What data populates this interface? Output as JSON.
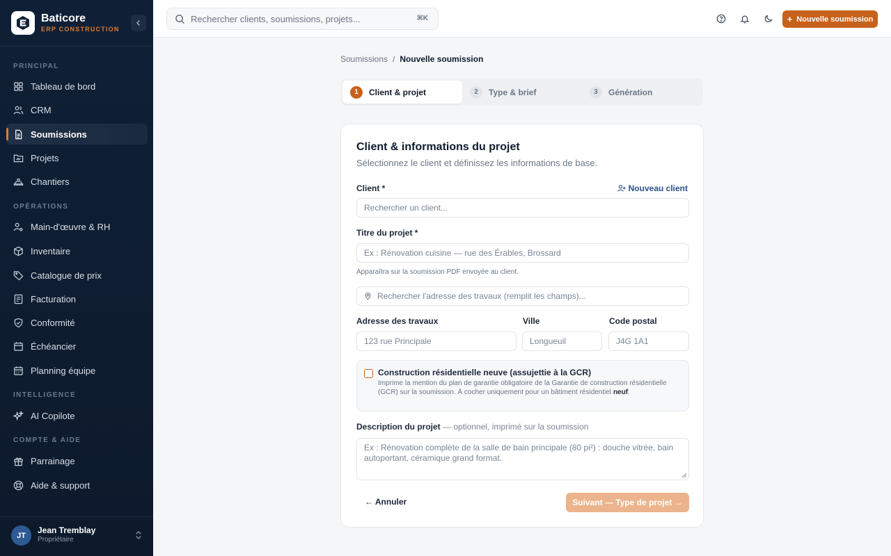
{
  "app": {
    "name": "Baticore",
    "subtitle": "ERP CONSTRUCTION"
  },
  "colors": {
    "accent": "#c8611b",
    "sidebar_bg": "#0f2036",
    "link": "#2a4f86"
  },
  "sidebar": {
    "sections": [
      {
        "label": "PRINCIPAL",
        "items": [
          {
            "label": "Tableau de bord",
            "icon": "dashboard-icon"
          },
          {
            "label": "CRM",
            "icon": "users-icon"
          },
          {
            "label": "Soumissions",
            "icon": "document-icon",
            "active": true
          },
          {
            "label": "Projets",
            "icon": "folder-icon"
          },
          {
            "label": "Chantiers",
            "icon": "hard-hat-icon"
          }
        ]
      },
      {
        "label": "OPÉRATIONS",
        "items": [
          {
            "label": "Main-d'œuvre & RH",
            "icon": "user-gear-icon"
          },
          {
            "label": "Inventaire",
            "icon": "box-icon"
          },
          {
            "label": "Catalogue de prix",
            "icon": "tag-icon"
          },
          {
            "label": "Facturation",
            "icon": "invoice-icon"
          },
          {
            "label": "Conformité",
            "icon": "shield-check-icon"
          },
          {
            "label": "Échéancier",
            "icon": "calendar-icon"
          },
          {
            "label": "Planning équipe",
            "icon": "calendar-grid-icon"
          }
        ]
      },
      {
        "label": "INTELLIGENCE",
        "items": [
          {
            "label": "AI Copilote",
            "icon": "sparkles-icon"
          }
        ]
      },
      {
        "label": "COMPTE & AIDE",
        "items": [
          {
            "label": "Parrainage",
            "icon": "gift-icon"
          },
          {
            "label": "Aide & support",
            "icon": "lifebuoy-icon"
          }
        ]
      }
    ],
    "user": {
      "initials": "JT",
      "name": "Jean Tremblay",
      "role": "Propriétaire"
    }
  },
  "topbar": {
    "search_placeholder": "Rechercher clients, soumissions, projets...",
    "shortcut": "⌘K",
    "new_button": "Nouvelle soumission"
  },
  "breadcrumb": {
    "parent": "Soumissions",
    "separator": "/",
    "current": "Nouvelle soumission"
  },
  "stepper": [
    {
      "num": "1",
      "label": "Client & projet",
      "active": true
    },
    {
      "num": "2",
      "label": "Type & brief",
      "active": false
    },
    {
      "num": "3",
      "label": "Génération",
      "active": false
    }
  ],
  "form": {
    "title": "Client & informations du projet",
    "subtitle": "Sélectionnez le client et définissez les informations de base.",
    "client_label": "Client *",
    "new_client_link": "Nouveau client",
    "client_placeholder": "Rechercher un client...",
    "project_title_label": "Titre du projet *",
    "project_title_placeholder": "Ex : Rénovation cuisine — rue des Érables, Brossard",
    "project_title_hint": "Apparaîtra sur la soumission PDF envoyée au client.",
    "address_search_placeholder": "Rechercher l'adresse des travaux (remplit les champs)...",
    "address_label": "Adresse des travaux",
    "address_placeholder": "123 rue Principale",
    "city_label": "Ville",
    "city_placeholder": "Longueuil",
    "postal_label": "Code postal",
    "postal_placeholder": "J4G 1A1",
    "gcr_title": "Construction résidentielle neuve (assujettie à la GCR)",
    "gcr_desc": "Imprime la mention du plan de garantie obligatoire de la Garantie de construction résidentielle (GCR) sur la soumission. À cocher uniquement pour un bâtiment résidentiel",
    "gcr_desc_bold": "neuf",
    "gcr_checked": false,
    "description_label": "Description du projet",
    "description_muted": "— optionnel, imprimé sur la soumission",
    "description_placeholder": "Ex : Rénovation complète de la salle de bain principale (80 pi²) : douche vitrée, bain autoportant, céramique grand format.",
    "cancel_label": "← Annuler",
    "next_label": "Suivant — Type de projet →"
  }
}
